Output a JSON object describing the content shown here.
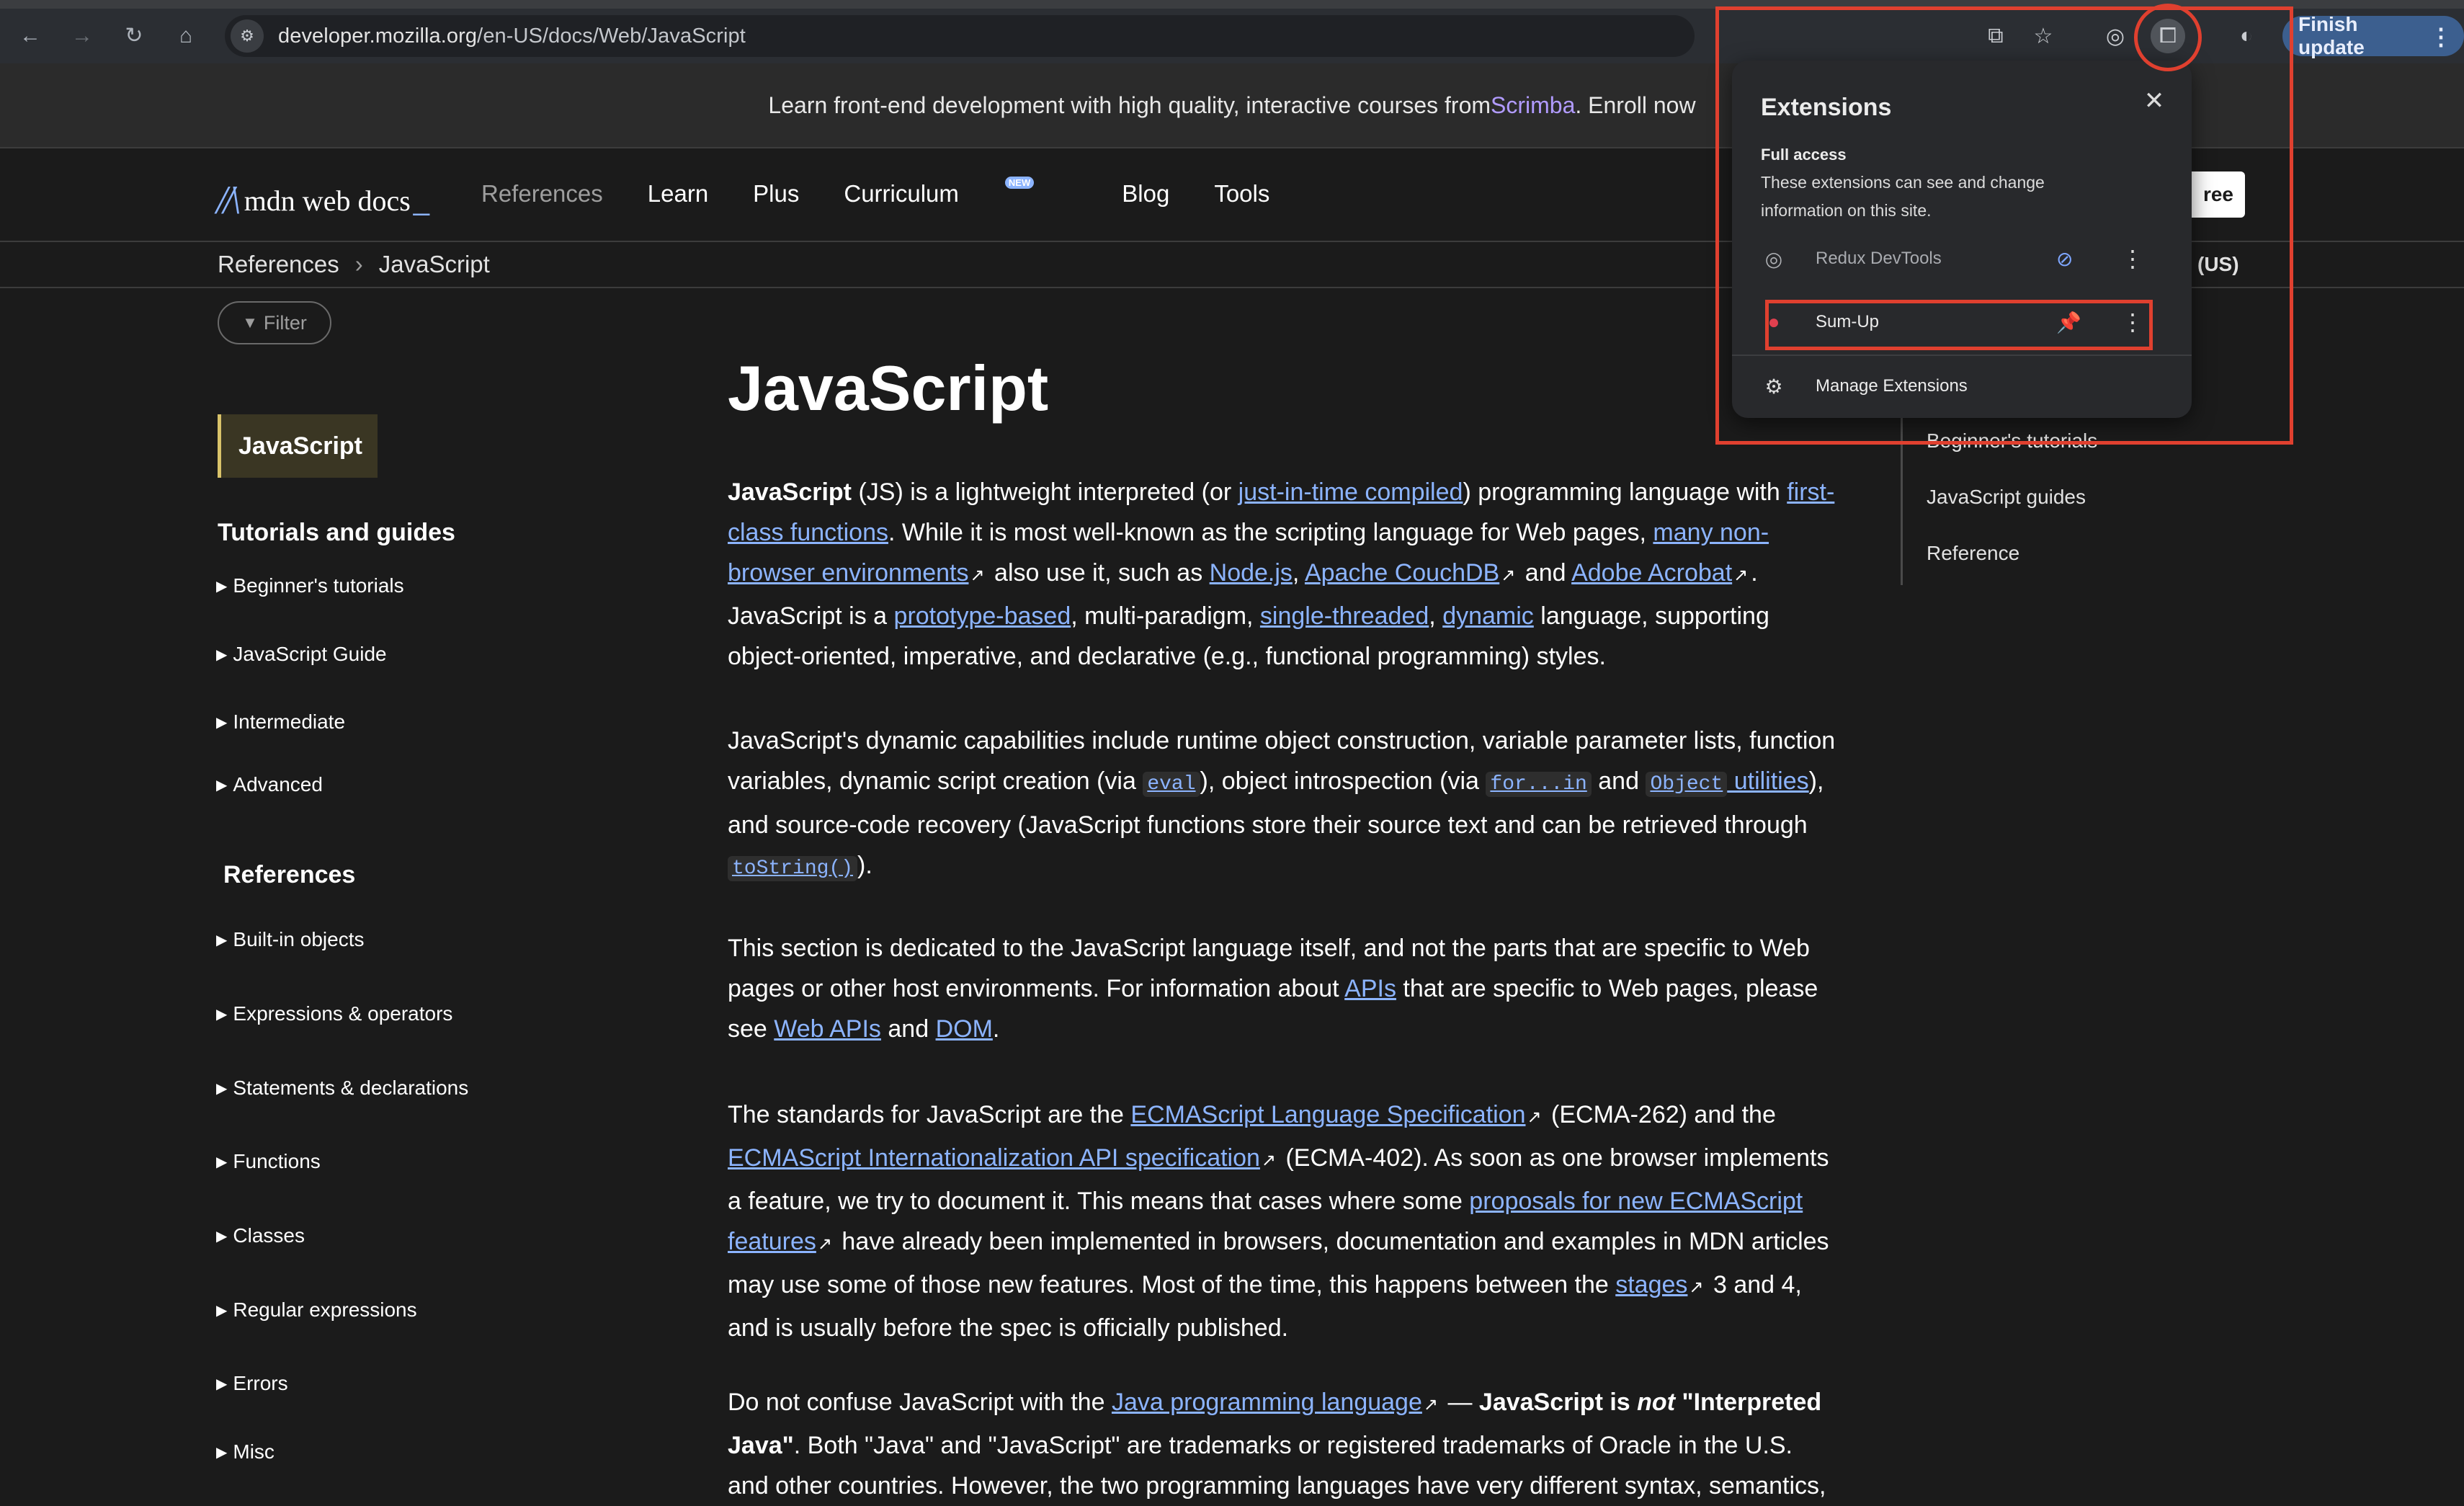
{
  "browser": {
    "url_host": "developer.mozilla.org",
    "url_path": "/en-US/docs/Web/JavaScript",
    "finish_update": "Finish update"
  },
  "banner": {
    "text_before": "Learn front-end development with high quality, interactive courses from ",
    "link": "Scrimba",
    "text_after": ". Enroll now"
  },
  "header": {
    "logo_text": "mdn web docs",
    "nav": [
      "References",
      "Learn",
      "Plus",
      "Curriculum",
      "Blog",
      "Tools"
    ],
    "new_badge": "NEW",
    "free_button": "ree"
  },
  "breadcrumb": {
    "items": [
      "References",
      "JavaScript"
    ],
    "lang": "(US)"
  },
  "sidebar": {
    "filter": "Filter",
    "current": "JavaScript",
    "sections": [
      {
        "title": "Tutorials and guides",
        "items": [
          "Beginner's tutorials",
          "JavaScript Guide",
          "Intermediate",
          "Advanced"
        ]
      },
      {
        "title": "References",
        "items": [
          "Built-in objects",
          "Expressions & operators",
          "Statements & declarations",
          "Functions",
          "Classes",
          "Regular expressions",
          "Errors",
          "Misc"
        ]
      }
    ]
  },
  "article": {
    "title": "JavaScript",
    "p1": {
      "t1": "JavaScript",
      "t2": " (JS) is a lightweight interpreted (or ",
      "l1": "just-in-time compiled",
      "t3": ") programming language with ",
      "l2": "first-class functions",
      "t4": ". While it is most well-known as the scripting language for Web pages, ",
      "l3": "many non-browser environments",
      "t5": " also use it, such as ",
      "l4": "Node.js",
      "t6": ", ",
      "l5": "Apache CouchDB",
      "t7": " and ",
      "l6": "Adobe Acrobat",
      "t8": ". JavaScript is a ",
      "l7": "prototype-based",
      "t9": ", multi-paradigm, ",
      "l8": "single-threaded",
      "t10": ", ",
      "l9": "dynamic",
      "t11": " language, supporting object-oriented, imperative, and declarative (e.g., functional programming) styles."
    },
    "p2": {
      "t1": "JavaScript's dynamic capabilities include runtime object construction, variable parameter lists, function variables, dynamic script creation (via ",
      "c1": "eval",
      "t2": "), object introspection (via ",
      "c2": "for...in",
      "t3": " and ",
      "c3": "Object",
      "l1": " utilities",
      "t4": "), and source-code recovery (JavaScript functions store their source text and can be retrieved through ",
      "c4": "toString()",
      "t5": ")."
    },
    "p3": {
      "t1": "This section is dedicated to the JavaScript language itself, and not the parts that are specific to Web pages or other host environments. For information about ",
      "l1": "APIs",
      "t2": " that are specific to Web pages, please see ",
      "l2": "Web APIs",
      "t3": " and ",
      "l3": "DOM",
      "t4": "."
    },
    "p4": {
      "t1": "The standards for JavaScript are the ",
      "l1": "ECMAScript Language Specification",
      "t2": " (ECMA-262) and the ",
      "l2": "ECMAScript Internationalization API specification",
      "t3": " (ECMA-402). As soon as one browser implements a feature, we try to document it. This means that cases where some ",
      "l3": "proposals for new ECMAScript features",
      "t4": " have already been implemented in browsers, documentation and examples in MDN articles may use some of those new features. Most of the time, this happens between the ",
      "l4": "stages",
      "t5": " 3 and 4, and is usually before the spec is officially published."
    },
    "p5": {
      "t1": "Do not confuse JavaScript with the ",
      "l1": "Java programming language",
      "t2": " — ",
      "b1": "JavaScript is ",
      "i1": "not",
      "b2": " \"Interpreted Java\"",
      "t3": ". Both \"Java\" and \"JavaScript\" are trademarks or registered trademarks of Oracle in the U.S. and other countries. However, the two programming languages have very different syntax, semantics,"
    }
  },
  "toc": [
    "Beginner's tutorials",
    "JavaScript guides",
    "Reference"
  ],
  "extensions_popup": {
    "title": "Extensions",
    "full_access": "Full access",
    "description": "These extensions can see and change information on this site.",
    "items": [
      {
        "name": "Redux DevTools",
        "pinned": false
      },
      {
        "name": "Sum-Up",
        "pinned": true
      }
    ],
    "manage": "Manage Extensions"
  },
  "colors": {
    "accent_link": "#8cb4ff",
    "annotation": "#e0402f",
    "scrimba": "#b19bff"
  }
}
